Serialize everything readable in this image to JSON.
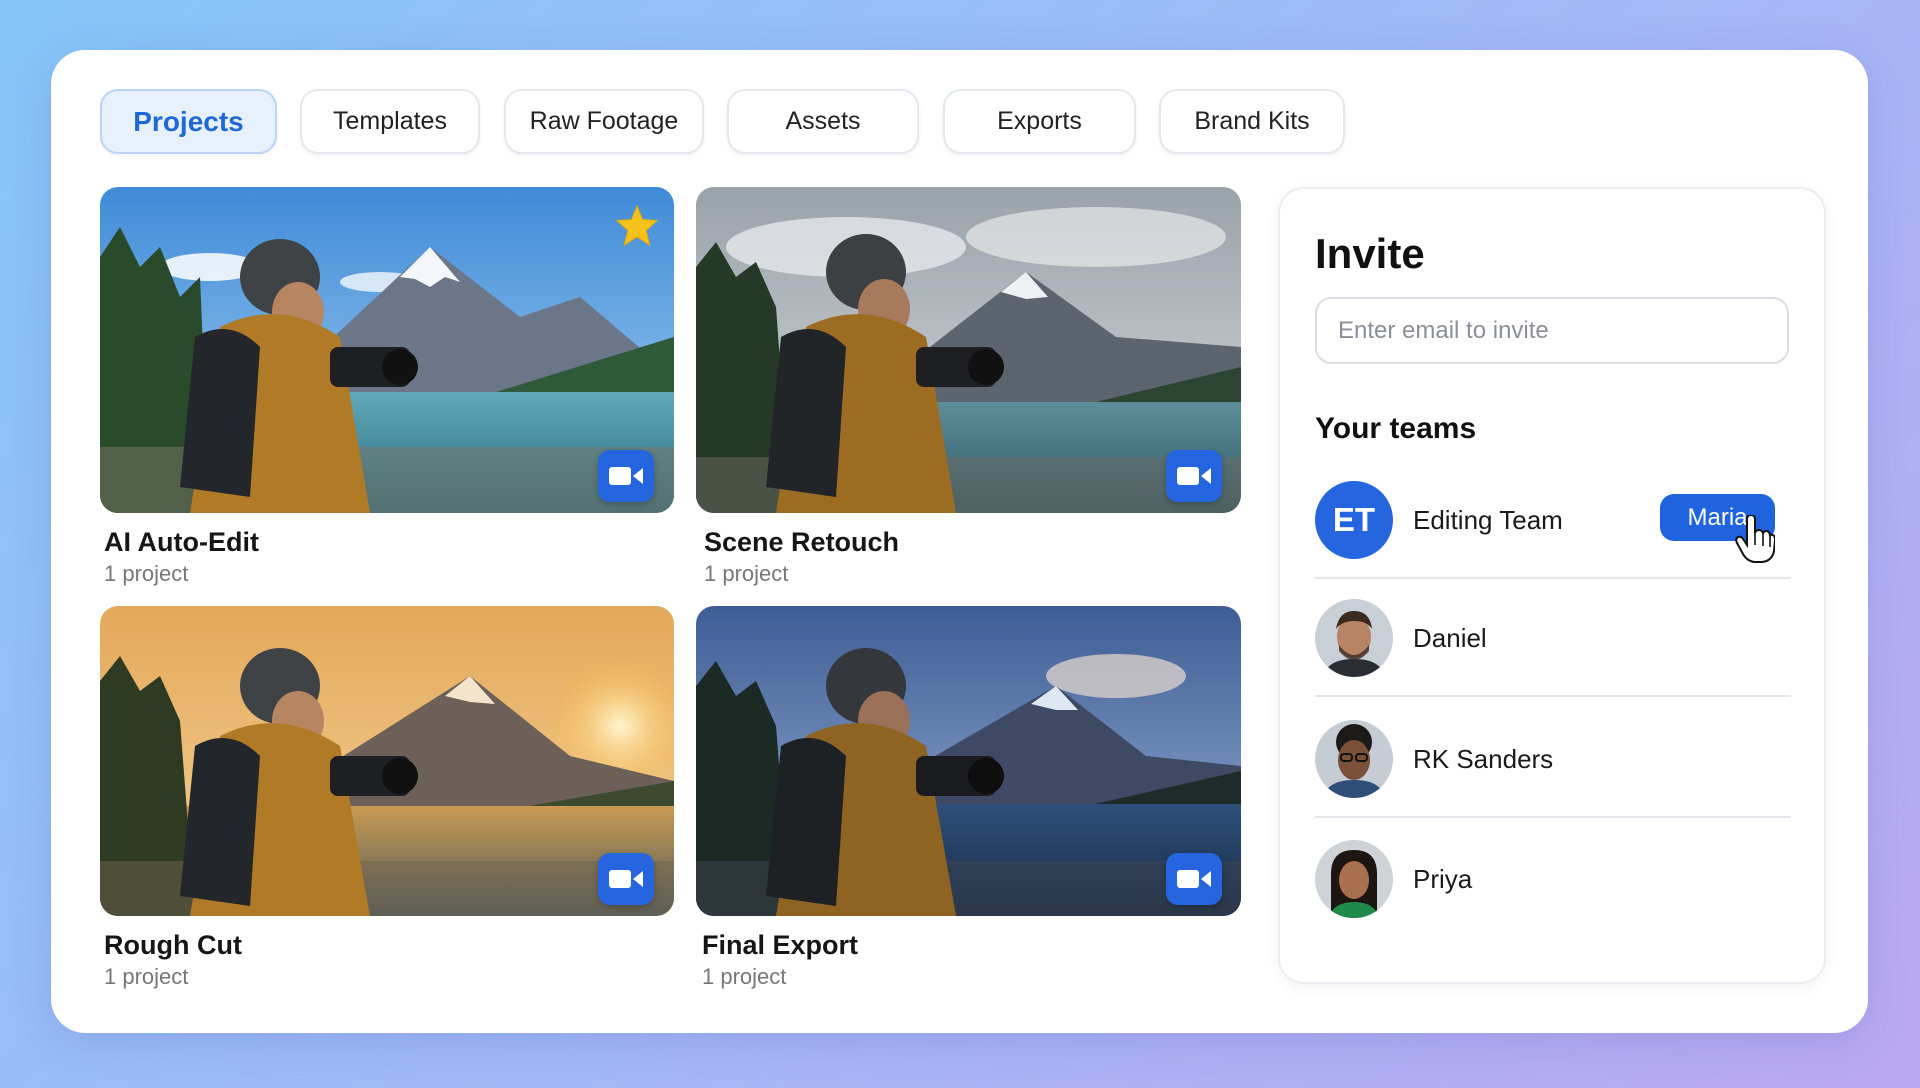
{
  "tabs": [
    {
      "label": "Projects",
      "active": true
    },
    {
      "label": "Templates",
      "active": false
    },
    {
      "label": "Raw Footage",
      "active": false
    },
    {
      "label": "Assets",
      "active": false
    },
    {
      "label": "Exports",
      "active": false
    },
    {
      "label": "Brand Kits",
      "active": false
    }
  ],
  "projects": [
    {
      "title": "AI Auto-Edit",
      "subtitle": "1 project",
      "starred": true,
      "icon": "video-camera-icon",
      "mood": "bright daylight"
    },
    {
      "title": "Scene Retouch",
      "subtitle": "1 project",
      "starred": false,
      "icon": "video-camera-icon",
      "mood": "overcast"
    },
    {
      "title": "Rough Cut",
      "subtitle": "1 project",
      "starred": false,
      "icon": "video-camera-icon",
      "mood": "golden sunset"
    },
    {
      "title": "Final Export",
      "subtitle": "1 project",
      "starred": false,
      "icon": "video-camera-icon",
      "mood": "blue dusk"
    }
  ],
  "invite": {
    "title": "Invite",
    "email_placeholder": "Enter email to invite",
    "email_value": "",
    "teams_title": "Your teams",
    "members": [
      {
        "name": "Editing Team",
        "initials": "ET",
        "action_label": "Maria"
      },
      {
        "name": "Daniel"
      },
      {
        "name": "RK Sanders"
      },
      {
        "name": "Priya"
      }
    ]
  },
  "colors": {
    "accent": "#2566e0",
    "active_tab_bg": "#e7f0fd",
    "active_tab_text": "#1f68d8",
    "star": "#f5c21b"
  }
}
